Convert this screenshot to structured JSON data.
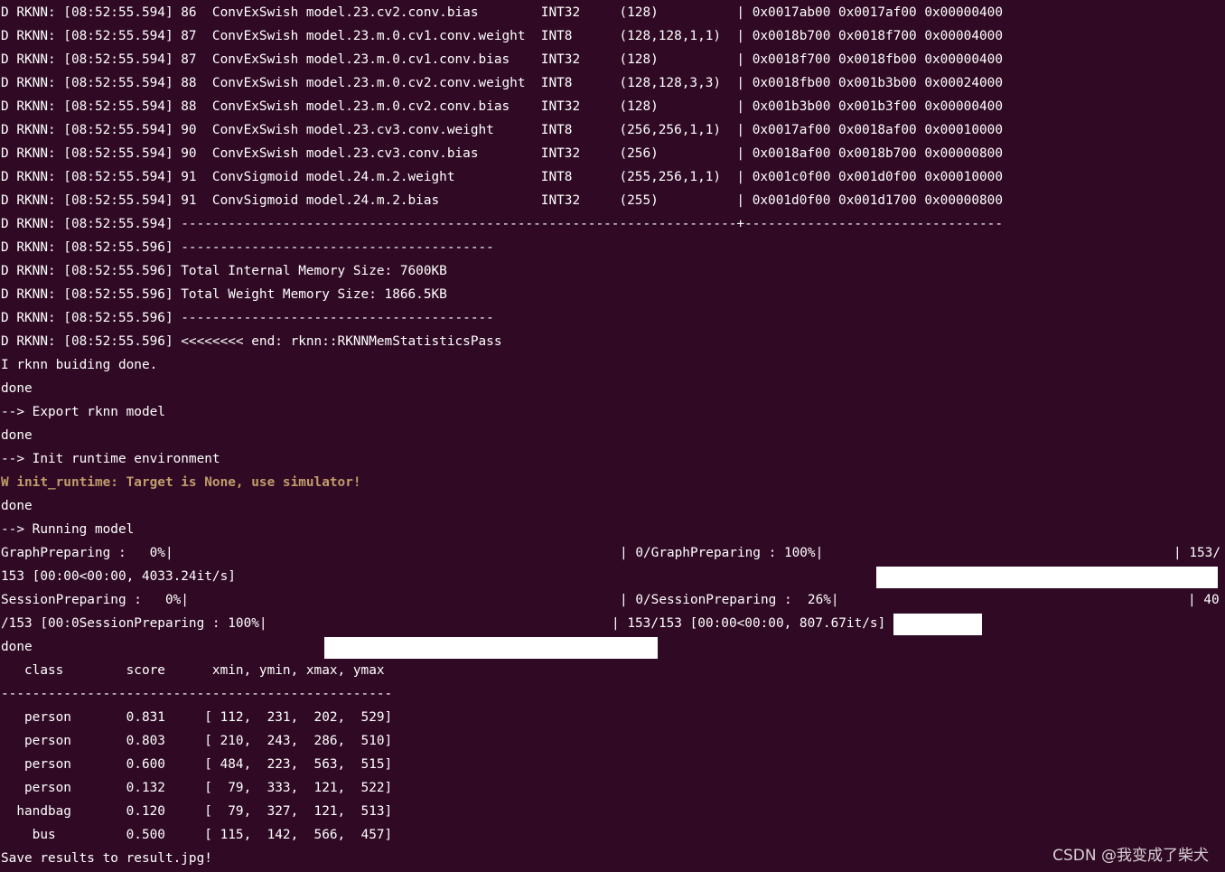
{
  "terminal": {
    "lines": {
      "l0": "D RKNN: [08:52:55.594] 86  ConvExSwish model.23.cv2.conv.bias        INT32     (128)          | 0x0017ab00 0x0017af00 0x00000400",
      "l1": "D RKNN: [08:52:55.594] 87  ConvExSwish model.23.m.0.cv1.conv.weight  INT8      (128,128,1,1)  | 0x0018b700 0x0018f700 0x00004000",
      "l2": "D RKNN: [08:52:55.594] 87  ConvExSwish model.23.m.0.cv1.conv.bias    INT32     (128)          | 0x0018f700 0x0018fb00 0x00000400",
      "l3": "D RKNN: [08:52:55.594] 88  ConvExSwish model.23.m.0.cv2.conv.weight  INT8      (128,128,3,3)  | 0x0018fb00 0x001b3b00 0x00024000",
      "l4": "D RKNN: [08:52:55.594] 88  ConvExSwish model.23.m.0.cv2.conv.bias    INT32     (128)          | 0x001b3b00 0x001b3f00 0x00000400",
      "l5": "D RKNN: [08:52:55.594] 90  ConvExSwish model.23.cv3.conv.weight      INT8      (256,256,1,1)  | 0x0017af00 0x0018af00 0x00010000",
      "l6": "D RKNN: [08:52:55.594] 90  ConvExSwish model.23.cv3.conv.bias        INT32     (256)          | 0x0018af00 0x0018b700 0x00000800",
      "l7": "D RKNN: [08:52:55.594] 91  ConvSigmoid model.24.m.2.weight           INT8      (255,256,1,1)  | 0x001c0f00 0x001d0f00 0x00010000",
      "l8": "D RKNN: [08:52:55.594] 91  ConvSigmoid model.24.m.2.bias             INT32     (255)          | 0x001d0f00 0x001d1700 0x00000800",
      "l9": "D RKNN: [08:52:55.594] -----------------------------------------------------------------------+---------------------------------",
      "l10": "D RKNN: [08:52:55.596] ----------------------------------------",
      "l11": "D RKNN: [08:52:55.596] Total Internal Memory Size: 7600KB",
      "l12": "D RKNN: [08:52:55.596] Total Weight Memory Size: 1866.5KB",
      "l13": "D RKNN: [08:52:55.596] ----------------------------------------",
      "l14": "D RKNN: [08:52:55.596] <<<<<<<< end: rknn::RKNNMemStatisticsPass",
      "l15": "I rknn buiding done.",
      "l16": "done",
      "l17": "--> Export rknn model",
      "l18": "done",
      "l19": "--> Init runtime environment",
      "l20": "W init_runtime: Target is None, use simulator!",
      "l21": "done",
      "l22": "--> Running model",
      "l23a": "GraphPreparing :   0%|",
      "l23b": "| 0/GraphPreparing : 100%|",
      "l23c": "| 153/",
      "l24": "153 [00:00<00:00, 4033.24it/s]",
      "l25a": "SessionPreparing :   0%|",
      "l25b": "| 0/SessionPreparing :  26%|",
      "l25c": "| 40",
      "l26a": "/153 [00:0SessionPreparing : 100%|",
      "l26b": "| 153/153 [00:00<00:00, 807.67it/s]",
      "l27": "done",
      "l28": "   class        score      xmin, ymin, xmax, ymax",
      "l29": "--------------------------------------------------",
      "l30": "   person       0.831     [ 112,  231,  202,  529]",
      "l31": "   person       0.803     [ 210,  243,  286,  510]",
      "l32": "   person       0.600     [ 484,  223,  563,  515]",
      "l33": "   person       0.132     [  79,  333,  121,  522]",
      "l34": "  handbag       0.120     [  79,  327,  121,  513]",
      "l35": "    bus         0.500     [ 115,  142,  566,  457]",
      "l36": "Save results to result.jpg!"
    },
    "progress": {
      "graph_preparing_fraction": 1.0,
      "session_preparing_partial_fraction": 0.26,
      "session_preparing_final_fraction": 1.0
    },
    "colors": {
      "background": "#300a24",
      "text": "#ffffff",
      "warning": "#c19c6b"
    }
  },
  "watermark": "CSDN @我变成了柴犬"
}
